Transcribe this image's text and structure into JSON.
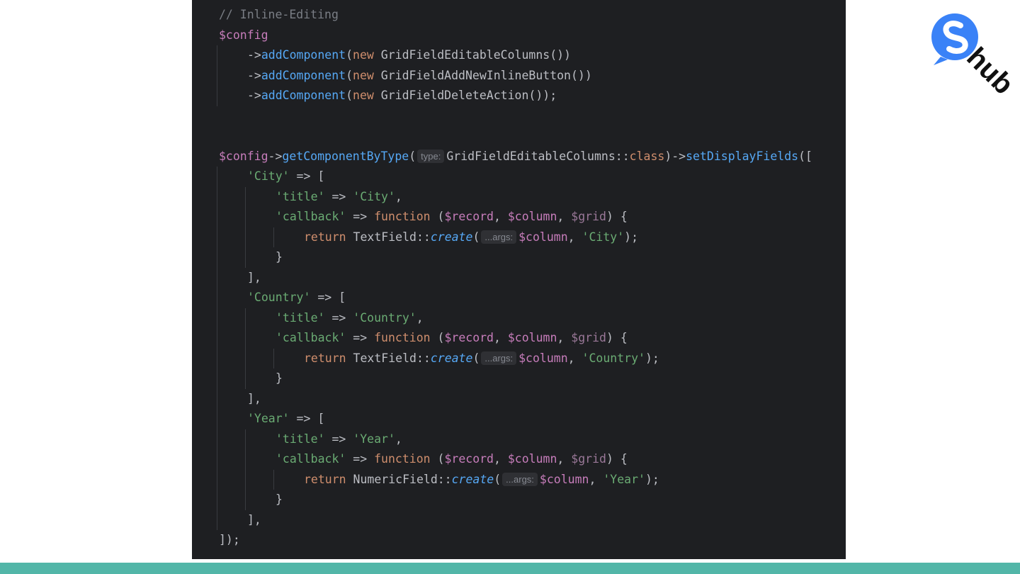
{
  "editor": {
    "lines": [
      {
        "indent": 0,
        "tokens": [
          {
            "t": "comment",
            "v": "// Inline-Editing"
          }
        ]
      },
      {
        "indent": 0,
        "tokens": [
          {
            "t": "var",
            "v": "$config"
          }
        ]
      },
      {
        "indent": 1,
        "tokens": [
          {
            "t": "plain",
            "v": "->"
          },
          {
            "t": "method",
            "v": "addComponent"
          },
          {
            "t": "plain",
            "v": "("
          },
          {
            "t": "keyword",
            "v": "new "
          },
          {
            "t": "plain",
            "v": "GridFieldEditableColumns())"
          }
        ]
      },
      {
        "indent": 1,
        "tokens": [
          {
            "t": "plain",
            "v": "->"
          },
          {
            "t": "method",
            "v": "addComponent"
          },
          {
            "t": "plain",
            "v": "("
          },
          {
            "t": "keyword",
            "v": "new "
          },
          {
            "t": "plain",
            "v": "GridFieldAddNewInlineButton())"
          }
        ]
      },
      {
        "indent": 1,
        "tokens": [
          {
            "t": "plain",
            "v": "->"
          },
          {
            "t": "method",
            "v": "addComponent"
          },
          {
            "t": "plain",
            "v": "("
          },
          {
            "t": "keyword",
            "v": "new "
          },
          {
            "t": "plain",
            "v": "GridFieldDeleteAction());"
          }
        ]
      },
      {
        "indent": 0,
        "tokens": []
      },
      {
        "indent": 0,
        "tokens": []
      },
      {
        "indent": 0,
        "tokens": [
          {
            "t": "var",
            "v": "$config"
          },
          {
            "t": "plain",
            "v": "->"
          },
          {
            "t": "method",
            "v": "getComponentByType"
          },
          {
            "t": "plain",
            "v": "("
          },
          {
            "t": "hint",
            "v": "type:"
          },
          {
            "t": "plain",
            "v": "GridFieldEditableColumns::"
          },
          {
            "t": "keyword",
            "v": "class"
          },
          {
            "t": "plain",
            "v": ")->"
          },
          {
            "t": "method",
            "v": "setDisplayFields"
          },
          {
            "t": "plain",
            "v": "(["
          }
        ]
      },
      {
        "indent": 1,
        "tokens": [
          {
            "t": "string",
            "v": "'City'"
          },
          {
            "t": "plain",
            "v": " => ["
          }
        ]
      },
      {
        "indent": 2,
        "tokens": [
          {
            "t": "string",
            "v": "'title'"
          },
          {
            "t": "plain",
            "v": " => "
          },
          {
            "t": "string",
            "v": "'City'"
          },
          {
            "t": "plain",
            "v": ","
          }
        ]
      },
      {
        "indent": 2,
        "tokens": [
          {
            "t": "string",
            "v": "'callback'"
          },
          {
            "t": "plain",
            "v": " => "
          },
          {
            "t": "keyword",
            "v": "function"
          },
          {
            "t": "plain",
            "v": " ("
          },
          {
            "t": "var",
            "v": "$record"
          },
          {
            "t": "plain",
            "v": ", "
          },
          {
            "t": "var",
            "v": "$column"
          },
          {
            "t": "plain",
            "v": ", "
          },
          {
            "t": "var-dim",
            "v": "$grid"
          },
          {
            "t": "plain",
            "v": ") {"
          }
        ]
      },
      {
        "indent": 3,
        "tokens": [
          {
            "t": "keyword",
            "v": "return "
          },
          {
            "t": "plain",
            "v": "TextField::"
          },
          {
            "t": "static",
            "v": "create"
          },
          {
            "t": "plain",
            "v": "("
          },
          {
            "t": "hint",
            "v": "...args:"
          },
          {
            "t": "var",
            "v": "$column"
          },
          {
            "t": "plain",
            "v": ", "
          },
          {
            "t": "string",
            "v": "'City'"
          },
          {
            "t": "plain",
            "v": ");"
          }
        ]
      },
      {
        "indent": 2,
        "tokens": [
          {
            "t": "plain",
            "v": "}"
          }
        ]
      },
      {
        "indent": 1,
        "tokens": [
          {
            "t": "plain",
            "v": "],"
          }
        ]
      },
      {
        "indent": 1,
        "tokens": [
          {
            "t": "string",
            "v": "'Country'"
          },
          {
            "t": "plain",
            "v": " => ["
          }
        ]
      },
      {
        "indent": 2,
        "tokens": [
          {
            "t": "string",
            "v": "'title'"
          },
          {
            "t": "plain",
            "v": " => "
          },
          {
            "t": "string",
            "v": "'Country'"
          },
          {
            "t": "plain",
            "v": ","
          }
        ]
      },
      {
        "indent": 2,
        "tokens": [
          {
            "t": "string",
            "v": "'callback'"
          },
          {
            "t": "plain",
            "v": " => "
          },
          {
            "t": "keyword",
            "v": "function"
          },
          {
            "t": "plain",
            "v": " ("
          },
          {
            "t": "var",
            "v": "$record"
          },
          {
            "t": "plain",
            "v": ", "
          },
          {
            "t": "var",
            "v": "$column"
          },
          {
            "t": "plain",
            "v": ", "
          },
          {
            "t": "var-dim",
            "v": "$grid"
          },
          {
            "t": "plain",
            "v": ") {"
          }
        ]
      },
      {
        "indent": 3,
        "tokens": [
          {
            "t": "keyword",
            "v": "return "
          },
          {
            "t": "plain",
            "v": "TextField::"
          },
          {
            "t": "static",
            "v": "create"
          },
          {
            "t": "plain",
            "v": "("
          },
          {
            "t": "hint",
            "v": "...args:"
          },
          {
            "t": "var",
            "v": "$column"
          },
          {
            "t": "plain",
            "v": ", "
          },
          {
            "t": "string",
            "v": "'Country'"
          },
          {
            "t": "plain",
            "v": ");"
          }
        ]
      },
      {
        "indent": 2,
        "tokens": [
          {
            "t": "plain",
            "v": "}"
          }
        ]
      },
      {
        "indent": 1,
        "tokens": [
          {
            "t": "plain",
            "v": "],"
          }
        ]
      },
      {
        "indent": 1,
        "tokens": [
          {
            "t": "string",
            "v": "'Year'"
          },
          {
            "t": "plain",
            "v": " => ["
          }
        ]
      },
      {
        "indent": 2,
        "tokens": [
          {
            "t": "string",
            "v": "'title'"
          },
          {
            "t": "plain",
            "v": " => "
          },
          {
            "t": "string",
            "v": "'Year'"
          },
          {
            "t": "plain",
            "v": ","
          }
        ]
      },
      {
        "indent": 2,
        "tokens": [
          {
            "t": "string",
            "v": "'callback'"
          },
          {
            "t": "plain",
            "v": " => "
          },
          {
            "t": "keyword",
            "v": "function"
          },
          {
            "t": "plain",
            "v": " ("
          },
          {
            "t": "var",
            "v": "$record"
          },
          {
            "t": "plain",
            "v": ", "
          },
          {
            "t": "var",
            "v": "$column"
          },
          {
            "t": "plain",
            "v": ", "
          },
          {
            "t": "var-dim",
            "v": "$grid"
          },
          {
            "t": "plain",
            "v": ") {"
          }
        ]
      },
      {
        "indent": 3,
        "tokens": [
          {
            "t": "keyword",
            "v": "return "
          },
          {
            "t": "plain",
            "v": "NumericField::"
          },
          {
            "t": "static",
            "v": "create"
          },
          {
            "t": "plain",
            "v": "("
          },
          {
            "t": "hint",
            "v": "...args:"
          },
          {
            "t": "var",
            "v": "$column"
          },
          {
            "t": "plain",
            "v": ", "
          },
          {
            "t": "string",
            "v": "'Year'"
          },
          {
            "t": "plain",
            "v": ");"
          }
        ]
      },
      {
        "indent": 2,
        "tokens": [
          {
            "t": "plain",
            "v": "}"
          }
        ]
      },
      {
        "indent": 1,
        "tokens": [
          {
            "t": "plain",
            "v": "],"
          }
        ]
      },
      {
        "indent": 0,
        "tokens": [
          {
            "t": "plain",
            "v": "]);"
          }
        ]
      }
    ]
  },
  "logo": {
    "icon": "s-bubble-icon",
    "text": "hub",
    "color": "#3a82f7",
    "text_color": "#111111"
  },
  "colors": {
    "editor_background": "#1e1f22",
    "accent_bar": "#52b6a8",
    "comment": "#7a7e85",
    "variable": "#c77dbb",
    "method": "#56a8f5",
    "keyword": "#cf8e6d",
    "string": "#6aab73",
    "text": "#bcbec4",
    "hint_background": "#2f3034",
    "hint_text": "#868991"
  }
}
